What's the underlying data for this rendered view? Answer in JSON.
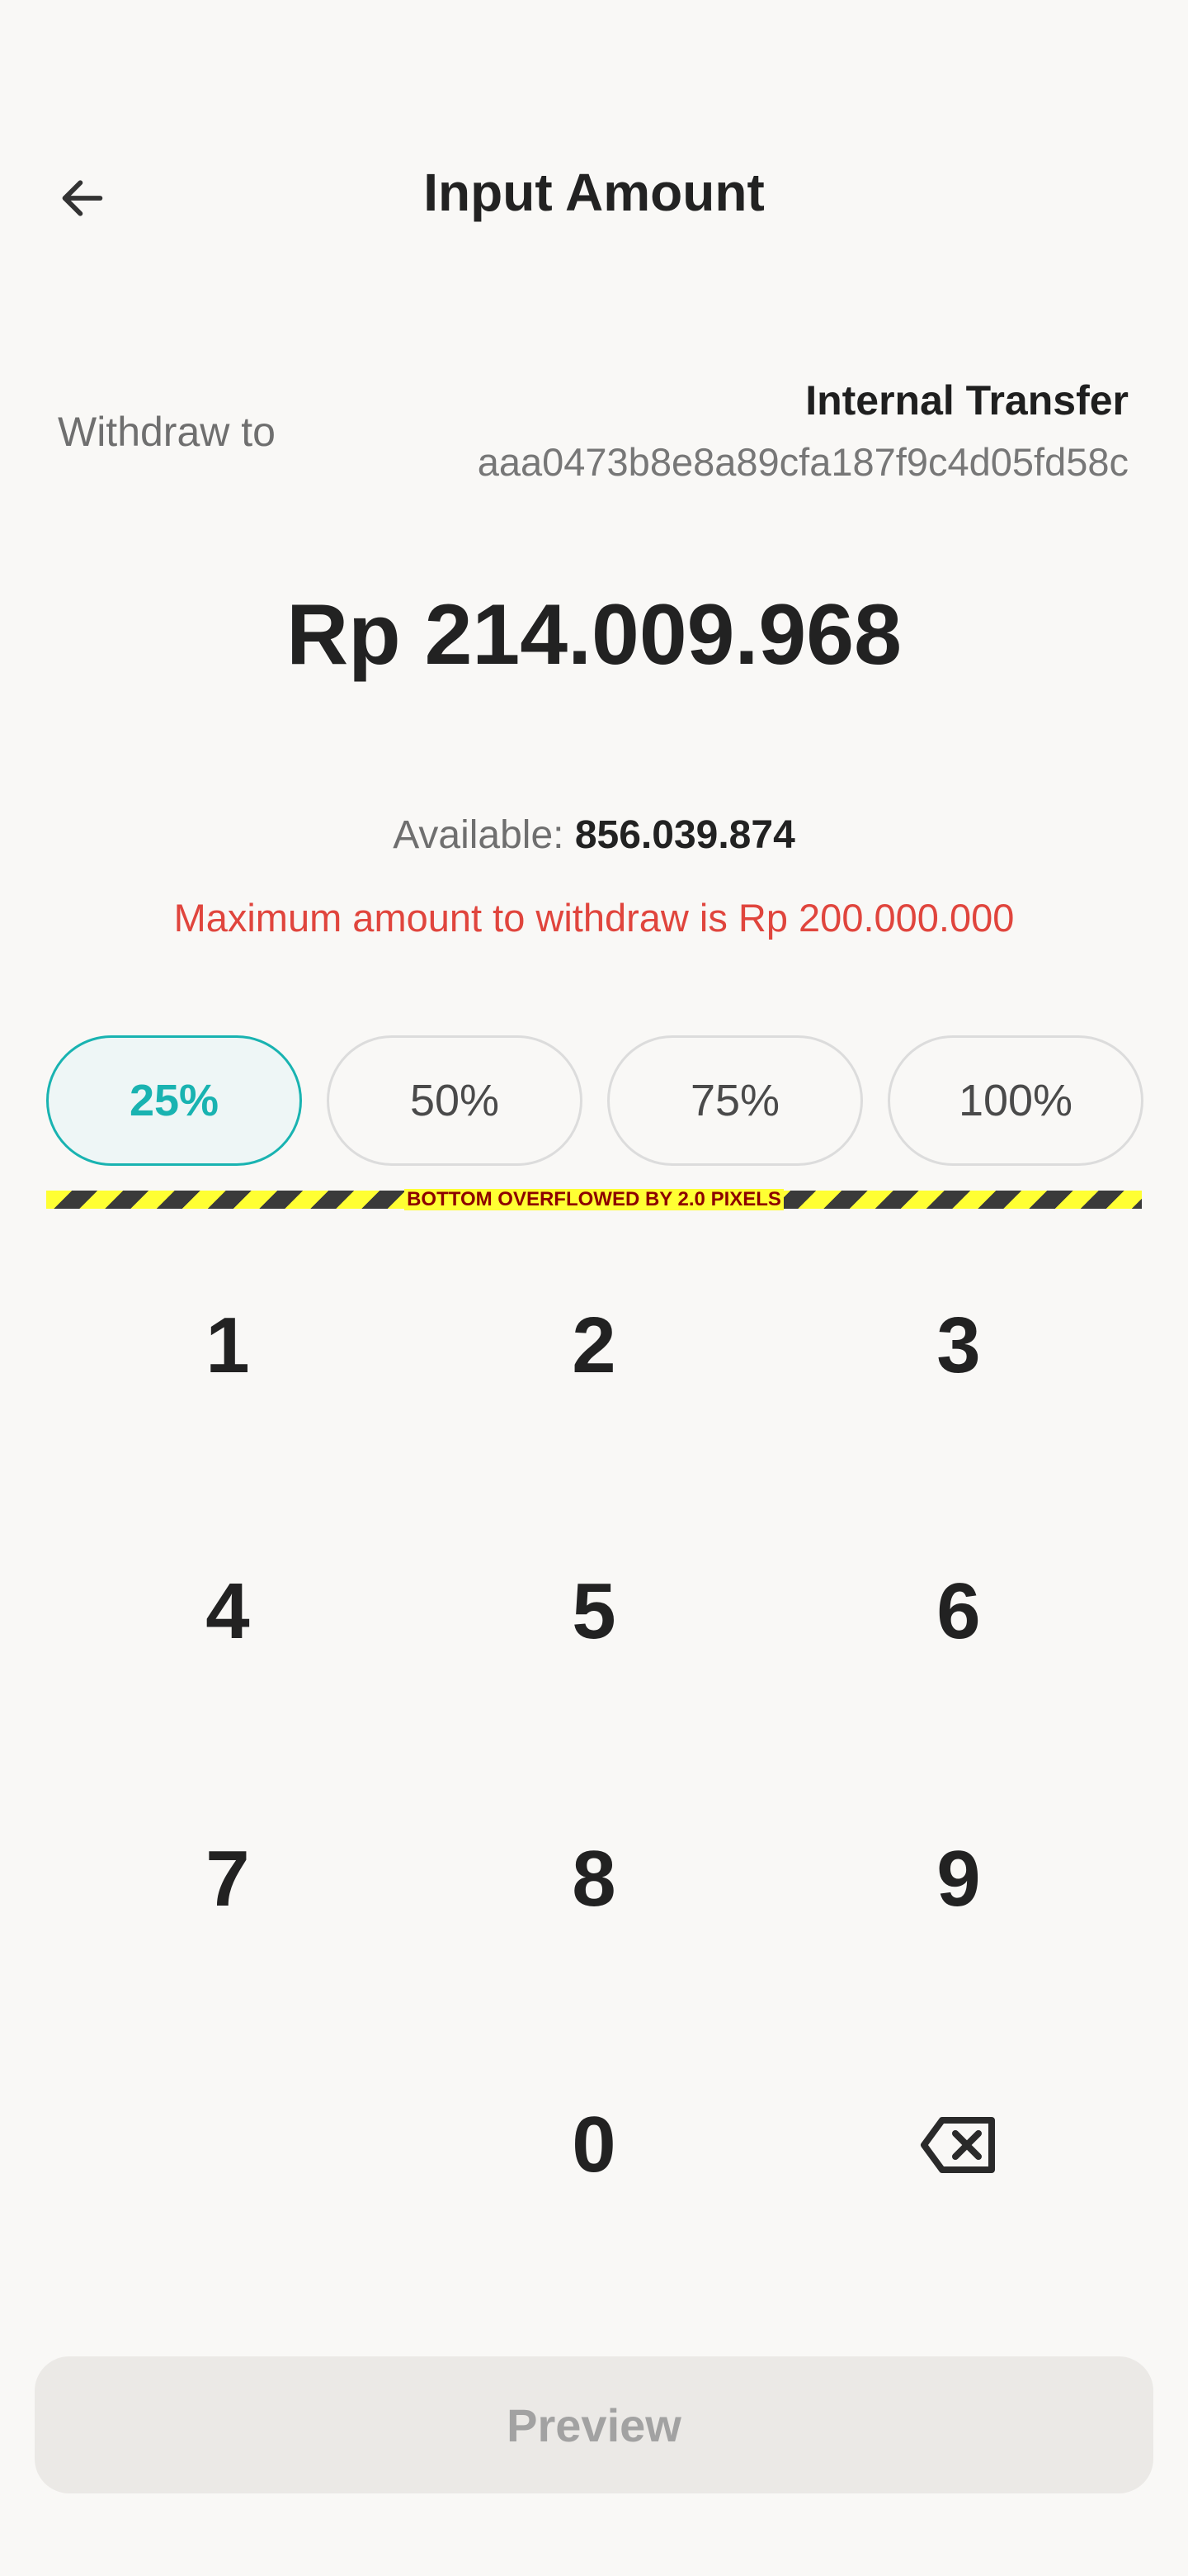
{
  "header": {
    "title": "Input Amount",
    "back_icon": "arrow-left-icon"
  },
  "withdraw": {
    "label": "Withdraw to",
    "destination_name": "Internal Transfer",
    "destination_account": "aaa0473b8e8a89cfa187f9c4d05fd58c"
  },
  "amount": {
    "display": "Rp 214.009.968"
  },
  "available": {
    "label": "Available:",
    "value": "856.039.874"
  },
  "error": {
    "message": "Maximum amount to withdraw is Rp 200.000.000"
  },
  "percent_options": [
    {
      "label": "25%",
      "selected": true
    },
    {
      "label": "50%",
      "selected": false
    },
    {
      "label": "75%",
      "selected": false
    },
    {
      "label": "100%",
      "selected": false
    }
  ],
  "overflow_warning": {
    "text": "BOTTOM OVERFLOWED BY 2.0 PIXELS"
  },
  "keypad": {
    "keys": [
      "1",
      "2",
      "3",
      "4",
      "5",
      "6",
      "7",
      "8",
      "9",
      "0"
    ],
    "backspace_icon": "backspace-icon"
  },
  "preview_button": {
    "label": "Preview"
  },
  "colors": {
    "accent": "#19b3b1",
    "error": "#e0453d",
    "background": "#f9f8f6",
    "disabled_button": "#ebe9e6"
  }
}
